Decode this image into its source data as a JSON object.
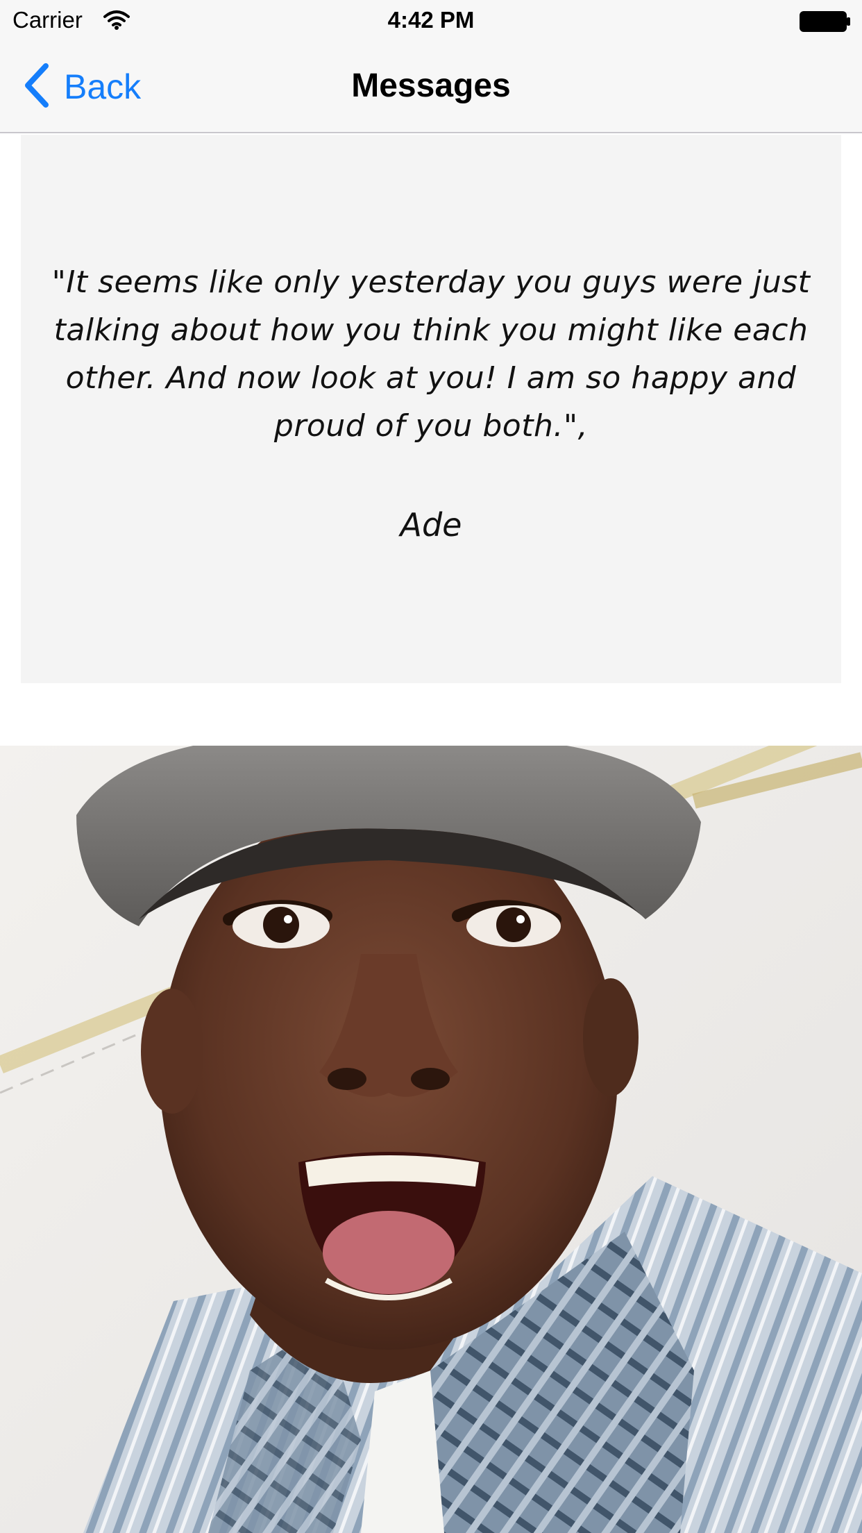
{
  "status_bar": {
    "carrier": "Carrier",
    "time": "4:42 PM",
    "icons": [
      "wifi-icon",
      "battery-icon"
    ]
  },
  "nav": {
    "back_label": "Back",
    "title": "Messages",
    "accent_color": "#157efb"
  },
  "message": {
    "quote": "\"It seems like only yesterday you guys were just talking about how you think you might like each other.  And now look at you! I am so happy and proud of you both.\",",
    "author": "Ade"
  },
  "photo": {
    "subject": "smiling man in grey cap and striped shirt"
  }
}
